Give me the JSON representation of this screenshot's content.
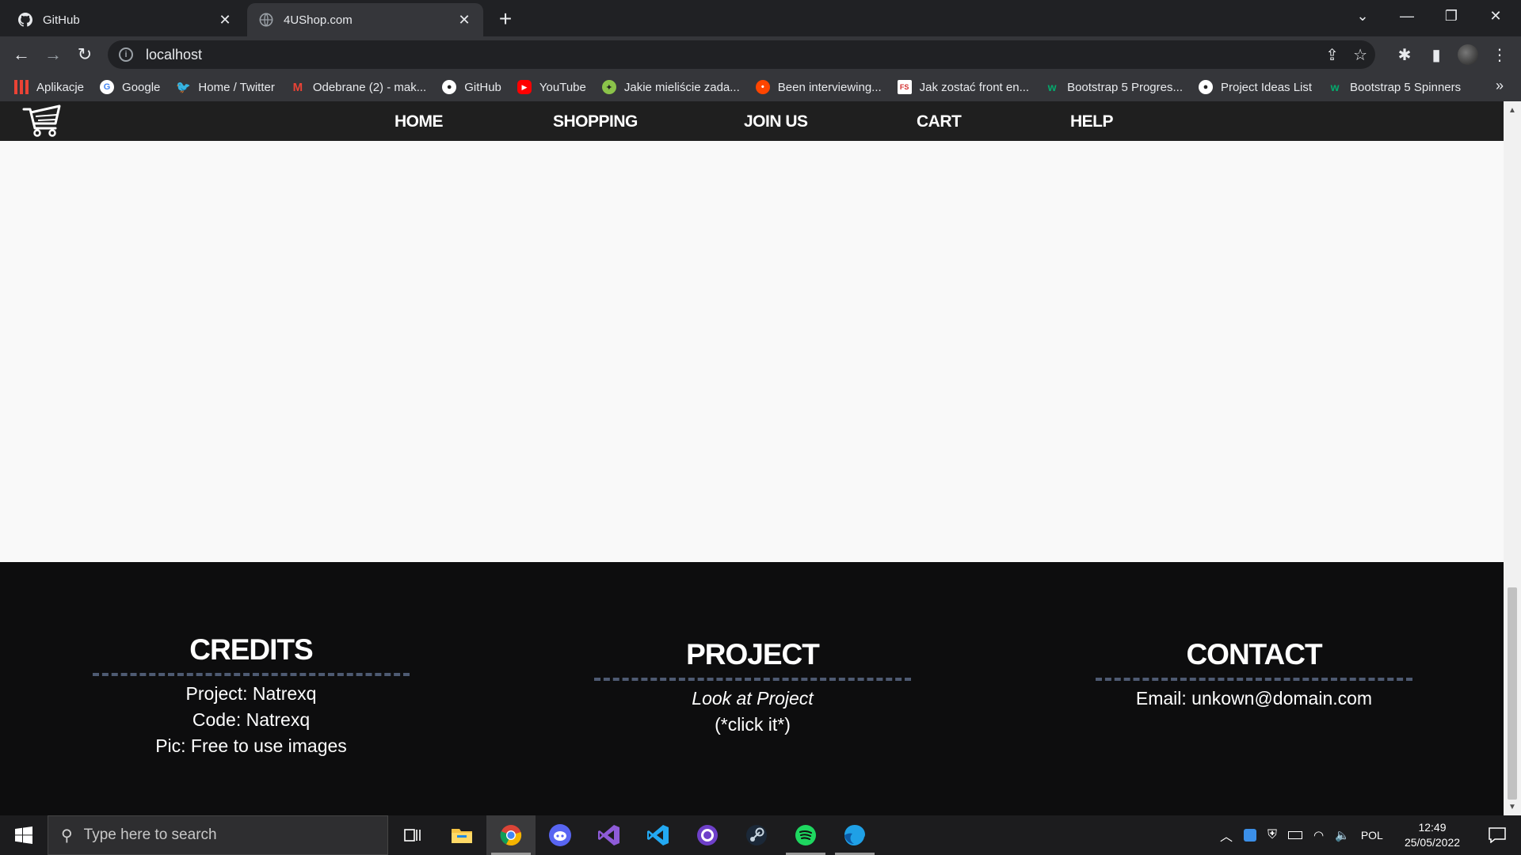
{
  "browser": {
    "tabs": [
      {
        "title": "GitHub",
        "icon": "github-icon",
        "active": false
      },
      {
        "title": "4UShop.com",
        "icon": "globe-icon",
        "active": true
      }
    ],
    "new_tab": "+",
    "url": "localhost",
    "bookmarks": [
      {
        "label": "Aplikacje",
        "icon": "apps-grid-icon",
        "color": "#ea4335"
      },
      {
        "label": "Google",
        "icon": "google-icon",
        "color": "#4285f4"
      },
      {
        "label": "Home / Twitter",
        "icon": "twitter-icon",
        "color": "#1da1f2"
      },
      {
        "label": "Odebrane (2) - mak...",
        "icon": "gmail-icon",
        "color": "#ea4335"
      },
      {
        "label": "GitHub",
        "icon": "github-icon",
        "color": "#ffffff"
      },
      {
        "label": "YouTube",
        "icon": "youtube-icon",
        "color": "#ff0000"
      },
      {
        "label": "Jakie mieliście zada...",
        "icon": "forum-icon",
        "color": "#8bc34a"
      },
      {
        "label": "Been interviewing...",
        "icon": "reddit-icon",
        "color": "#ff4500"
      },
      {
        "label": "Jak zostać front en...",
        "icon": "fs-icon",
        "color": "#ffffff"
      },
      {
        "label": "Bootstrap 5 Progres...",
        "icon": "w3-icon",
        "color": "#04aa6d"
      },
      {
        "label": "Project Ideas List",
        "icon": "github-icon",
        "color": "#ffffff"
      },
      {
        "label": "Bootstrap 5 Spinners",
        "icon": "w3-icon",
        "color": "#04aa6d"
      }
    ],
    "more_bookmarks": "»"
  },
  "site": {
    "nav": [
      "HOME",
      "SHOPPING",
      "JOIN US",
      "CART",
      "HELP"
    ],
    "footer": {
      "credits": {
        "title": "CREDITS",
        "lines": [
          "Project: Natrexq",
          "Code: Natrexq",
          "Pic: Free to use images"
        ]
      },
      "project": {
        "title": "PROJECT",
        "link": "Look at Project",
        "note": "(*click it*)"
      },
      "contact": {
        "title": "CONTACT",
        "email": "Email: unkown@domain.com"
      }
    },
    "colors": {
      "nav_bg": "#1f1f1f",
      "footer_bg": "#0d0d0e",
      "dash": "#4e5a72",
      "page_bg": "#f9f9f9"
    }
  },
  "taskbar": {
    "search_placeholder": "Type here to search",
    "apps": [
      "task-view-icon",
      "file-explorer-icon",
      "chrome-icon",
      "discord-icon",
      "visual-studio-icon",
      "vscode-icon",
      "github-desktop-icon",
      "steam-icon",
      "spotify-icon",
      "edge-icon"
    ],
    "language": "POL",
    "time": "12:49",
    "date": "25/05/2022"
  }
}
